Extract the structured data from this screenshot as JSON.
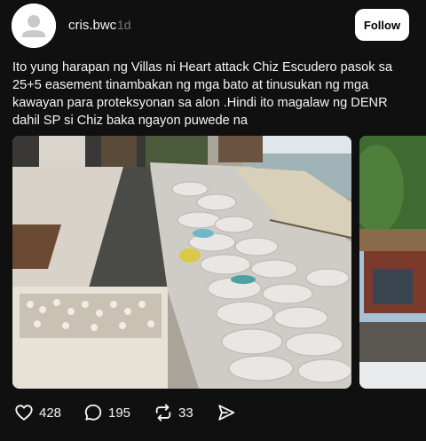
{
  "post": {
    "username": "cris.bwc",
    "time": "1d",
    "follow_label": "Follow",
    "text": "Ito yung harapan ng Villas ni Heart attack Chiz Escudero pasok sa 25+5 easement tinambakan ng mga bato at tinusukan ng mga kawayan para proteksyonan sa alon .Hindi ito magalaw ng DENR dahil SP si Chiz baka ngayon puwede na"
  },
  "actions": {
    "likes": "428",
    "comments": "195",
    "reposts": "33"
  },
  "icons": {
    "avatar": "default-avatar-icon",
    "like": "heart-icon",
    "comment": "comment-bubble-icon",
    "repost": "repost-icon",
    "share": "share-send-icon"
  },
  "colors": {
    "background": "#101010",
    "text": "#f3f5f7",
    "muted": "#777777",
    "follow_bg": "#ffffff"
  }
}
